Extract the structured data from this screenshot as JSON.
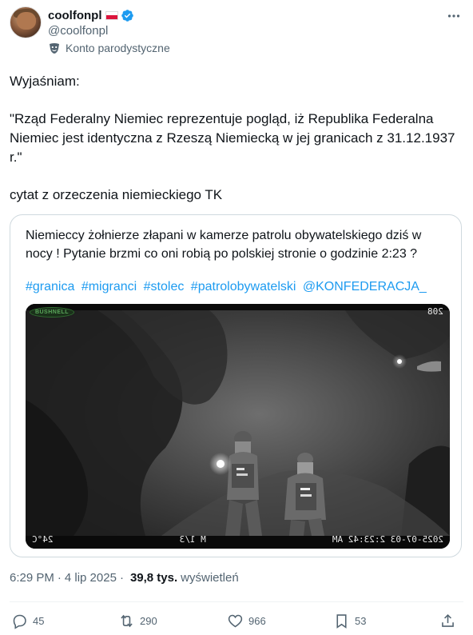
{
  "author": {
    "display_name": "coolfonpl",
    "handle": "@coolfonpl",
    "label": "Konto parodystyczne",
    "verified_color": "#1d9bf0"
  },
  "tweet": {
    "line1": "Wyjaśniam:",
    "line2": "\"Rząd Federalny Niemiec reprezentuje pogląd, iż Republika Federalna Niemiec jest identyczna z Rzeszą Niemiecką w jej granicach z 31.12.1937 r.\"",
    "line3": "cytat z orzeczenia niemieckiego TK"
  },
  "quoted": {
    "text": "Niemieccy żołnierze złapani w kamerze patrolu obywatelskiego dziś w nocy ! Pytanie brzmi co oni robią po polskiej stronie o godzinie 2:23 ?",
    "hashtags": [
      "#granica",
      "#migranci",
      "#stolec",
      "#patrolobywatelski",
      "@KONFEDERACJA_"
    ],
    "media": {
      "camera_id": "208",
      "camera_logo": "BUSHNELL",
      "bottom_left": "24°C",
      "bottom_middle": "M 1/3",
      "bottom_right": "2025-07-03 2:23:42 AM"
    }
  },
  "meta": {
    "time": "6:29 PM",
    "separator": "·",
    "date": "4 lip 2025",
    "views_count": "39,8 tys.",
    "views_label": "wyświetleń"
  },
  "actions": {
    "replies": "45",
    "reposts": "290",
    "likes": "966",
    "bookmarks": "53"
  },
  "colors": {
    "text": "#0f1419",
    "secondary": "#536471",
    "link": "#1d9bf0",
    "border": "#cfd9de"
  }
}
